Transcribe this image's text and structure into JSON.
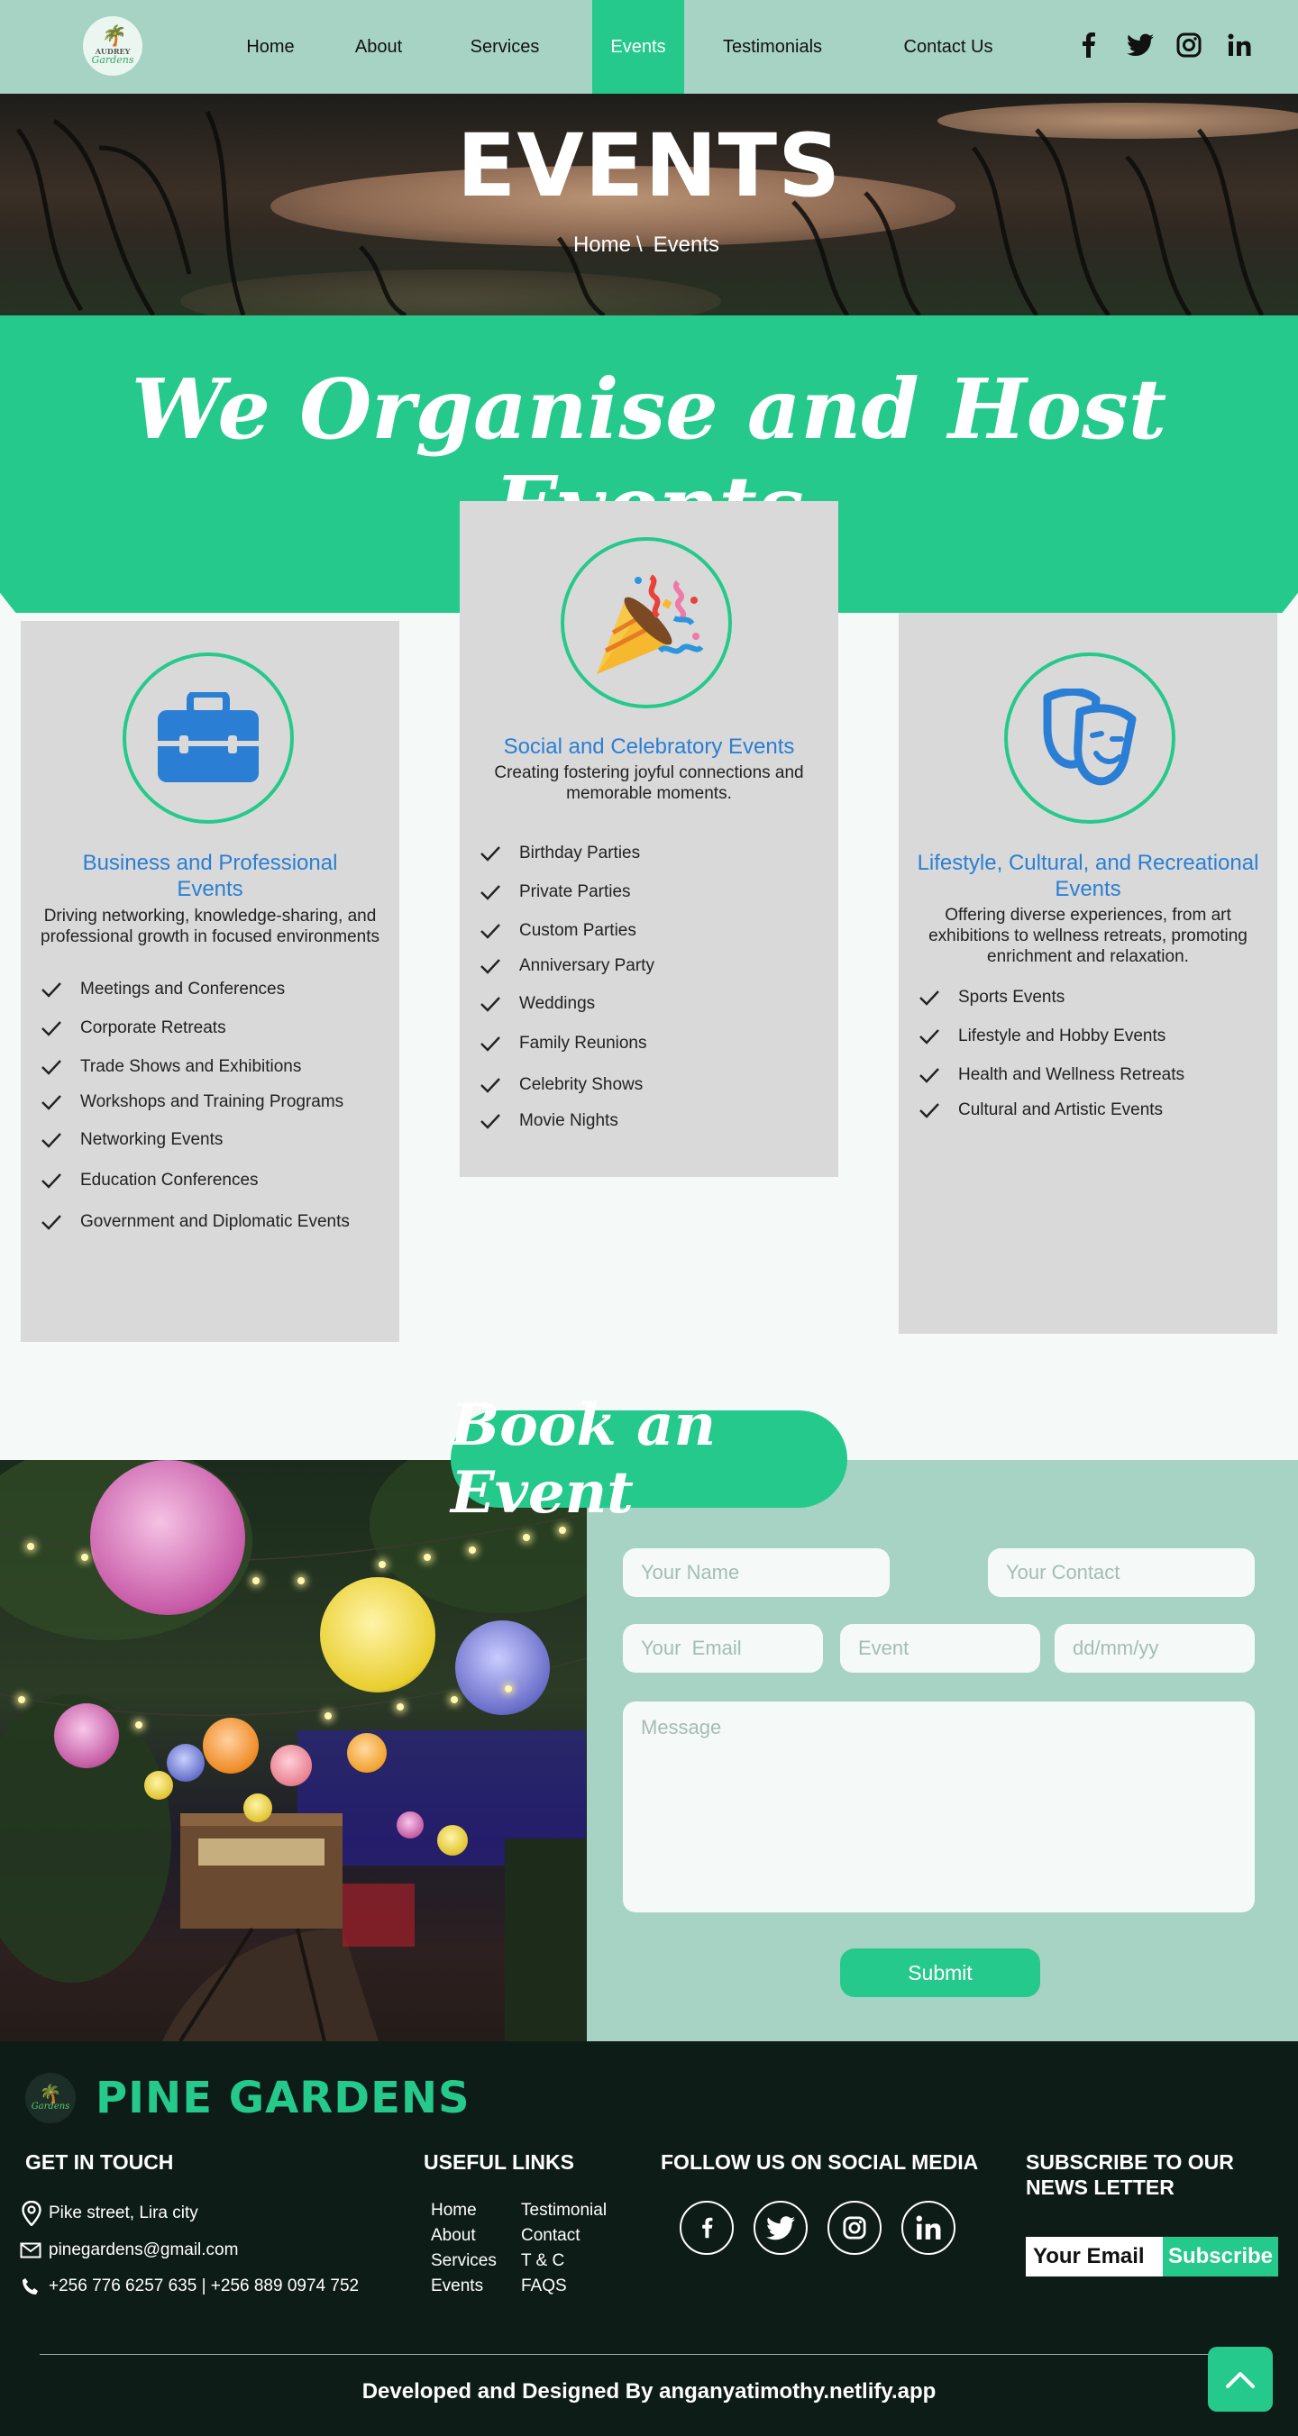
{
  "brand": {
    "logo_line1": "AUDREY",
    "logo_line2": "Gardens",
    "name": "PINE GARDENS"
  },
  "nav": {
    "home": "Home",
    "about": "About",
    "services": "Services",
    "events": "Events",
    "testimonials": "Testimonials",
    "contact": "Contact Us"
  },
  "colors": {
    "accent": "#25c98c",
    "nav_bg": "#a7d3c4",
    "title_blue": "#2a7fd4",
    "footer_bg": "#0e1c18"
  },
  "hero": {
    "title": "EVENTS",
    "crumb_home": "Home",
    "crumb_sep": "\\",
    "crumb_current": "Events"
  },
  "section": {
    "title": "We Organise and Host Events"
  },
  "cards": [
    {
      "icon": "briefcase-icon",
      "title_line1": "Business and Professional",
      "title_line2": "Events",
      "desc_line1": "Driving networking, knowledge-sharing, and",
      "desc_line2": "professional growth in focused environments",
      "items": [
        "Meetings and Conferences",
        "Corporate Retreats",
        "Trade Shows and Exhibitions",
        "Workshops and Training Programs",
        "Networking Events",
        "Education Conferences",
        "Government and Diplomatic Events"
      ]
    },
    {
      "icon": "party-popper-icon",
      "title_line1": "Social and Celebratory Events",
      "desc_line1": "Creating fostering joyful connections and",
      "desc_line2": "memorable moments.",
      "items": [
        "Birthday Parties",
        "Private Parties",
        "Custom Parties",
        "Anniversary Party",
        "Weddings",
        "Family Reunions",
        "Celebrity Shows",
        "Movie Nights"
      ]
    },
    {
      "icon": "theater-masks-icon",
      "title_line1": "Lifestyle, Cultural, and Recreational",
      "title_line2": "Events",
      "desc_line1": "Offering diverse experiences, from art",
      "desc_line2": "exhibitions to wellness retreats, promoting",
      "desc_line3": "enrichment and relaxation.",
      "items": [
        "Sports Events",
        "Lifestyle and Hobby Events",
        "Health and Wellness Retreats",
        "Cultural and Artistic Events"
      ]
    }
  ],
  "book": {
    "title": "Book an Event",
    "name_placeholder": "Your Name",
    "contact_placeholder": "Your Contact",
    "email_placeholder": "Your  Email",
    "event_placeholder": "Event",
    "date_placeholder": "dd/mm/yy",
    "message_placeholder": "Message",
    "submit": "Submit"
  },
  "footer": {
    "touch_title": "GET IN TOUCH",
    "address": "Pike street, Lira city",
    "email": "pinegardens@gmail.com",
    "phone": "+256 776 6257 635 | +256 889 0974 752",
    "links_title": "USEFUL LINKS",
    "links_col1": [
      "Home",
      "About",
      "Services",
      "Events"
    ],
    "links_col2": [
      "Testimonial",
      "Contact",
      "T & C",
      "FAQS"
    ],
    "social_title": "FOLLOW US ON SOCIAL MEDIA",
    "subscribe_title_line1": "SUBSCRIBE TO OUR",
    "subscribe_title_line2": "NEWS LETTER",
    "subscribe_input": "Your Email",
    "subscribe_button": "Subscribe",
    "credit": "Developed and Designed By anganyatimothy.netlify.app"
  }
}
